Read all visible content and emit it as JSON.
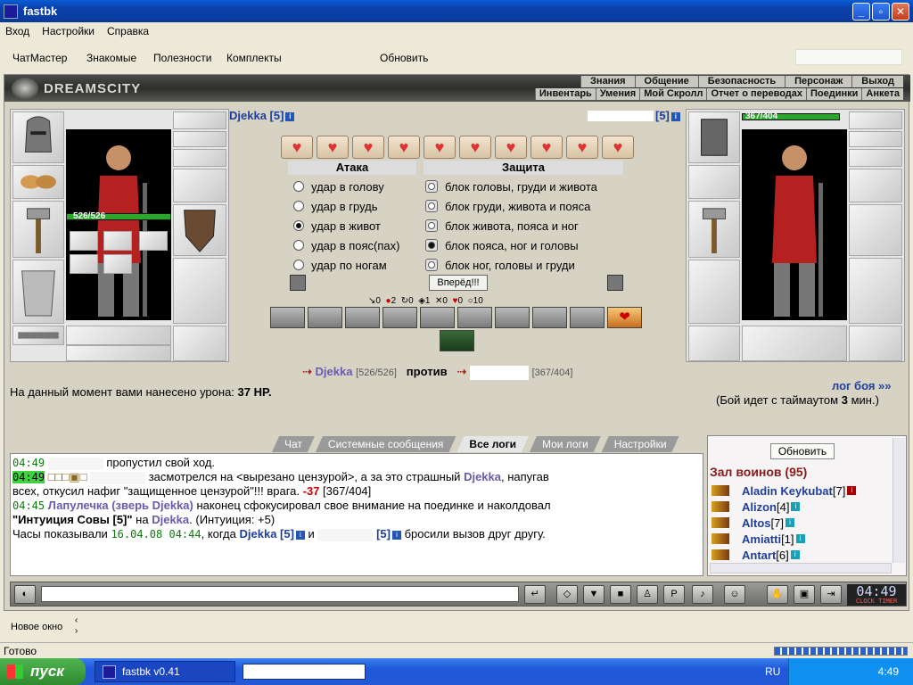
{
  "window": {
    "title": "fastbk"
  },
  "menu": [
    "Вход",
    "Настройки",
    "Справка"
  ],
  "toolbar": [
    "ЧатМастер",
    "Знакомые",
    "Полезности",
    "Комплекты",
    "Обновить"
  ],
  "game": {
    "logo": "DREAMSCITY",
    "nav_top": [
      "Знания",
      "Общение",
      "Безопасность",
      "Персонаж",
      "Выход"
    ],
    "nav_bottom": [
      "Инвентарь",
      "Умения",
      "Мой Скролл",
      "Отчет о переводах",
      "Поединки",
      "Анкета"
    ],
    "left_fighter": {
      "name": "Djekka [5]",
      "hp": "526/526"
    },
    "right_fighter": {
      "level": "[5]",
      "hp": "367/404"
    },
    "attack": {
      "header": "Атака",
      "options": [
        "удар в голову",
        "удар в грудь",
        "удар в живот",
        "удар в пояс(пах)",
        "удар по ногам"
      ],
      "selected": 2
    },
    "defense": {
      "header": "Защита",
      "options": [
        "блок головы, груди и живота",
        "блок груди, живота и пояса",
        "блок живота, пояса и ног",
        "блок пояса, ног и головы",
        "блок ног, головы и груди"
      ],
      "selected": 3
    },
    "forward_button": "Вперёд!!!",
    "counters": [
      "0",
      "2",
      "0",
      "1",
      "0",
      "0",
      "10"
    ],
    "versus": {
      "left_name": "Djekka",
      "left_hp": "[526/526]",
      "word": "против",
      "right_hp": "[367/404]"
    },
    "damage_text": "На данный момент вами нанесено урона:",
    "damage_value": "37 HP.",
    "log_link": "лог боя »»",
    "timeout_text": "(Бой идет с таймаутом",
    "timeout_value": "3",
    "timeout_unit": "мин.)"
  },
  "tabs": [
    "Чат",
    "Системные сообщения",
    "Все логи",
    "Мои логи",
    "Настройки"
  ],
  "log": {
    "line1": {
      "time": "04:49",
      "text": "пропустил свой ход."
    },
    "line2": {
      "time": "04:49",
      "marks": "□□□▣□",
      "text_a": "засмотрелся на <вырезано цензурой>, а за это страшный",
      "name": "Djekka",
      "text_b": ", напугав"
    },
    "line3": {
      "text": "всех, откусил нафиг \"защищенное цензурой\"!!! врага.",
      "damage": "-37",
      "hp": "[367/404]"
    },
    "line4": {
      "time": "04:45",
      "actor": "Лапулечка (зверь Djekka)",
      "text": "наконец сфокусировал свое внимание на поединке и наколдовал"
    },
    "line5": {
      "spell": "\"Интуиция Совы [5]\"",
      "on": "на",
      "target": "Djekka",
      "effect": ". (Интуиция: +5)"
    },
    "line6": {
      "text_a": "Часы показывали",
      "date": "16.04.08 04:44",
      "text_b": ", когда",
      "name": "Djekka [5]",
      "and": "и",
      "lvl": "[5]",
      "text_c": "бросили вызов друг другу."
    }
  },
  "side": {
    "refresh": "Обновить",
    "hall": "Зал воинов (95)",
    "players": [
      {
        "name": "Aladin Keykubat",
        "level": "[7]"
      },
      {
        "name": "Alizon",
        "level": "[4]"
      },
      {
        "name": "Altos",
        "level": "[7]"
      },
      {
        "name": "Amiatti",
        "level": "[1]"
      },
      {
        "name": "Antart",
        "level": "[6]"
      }
    ]
  },
  "clock": {
    "time": "04:49",
    "sec": "49",
    "labels": "CLOCK TIMER"
  },
  "new_window": "Новое окно",
  "status": "Готово",
  "taskbar": {
    "start": "пуск",
    "task": "fastbk v0.41",
    "lang": "RU",
    "time": "4:49"
  }
}
